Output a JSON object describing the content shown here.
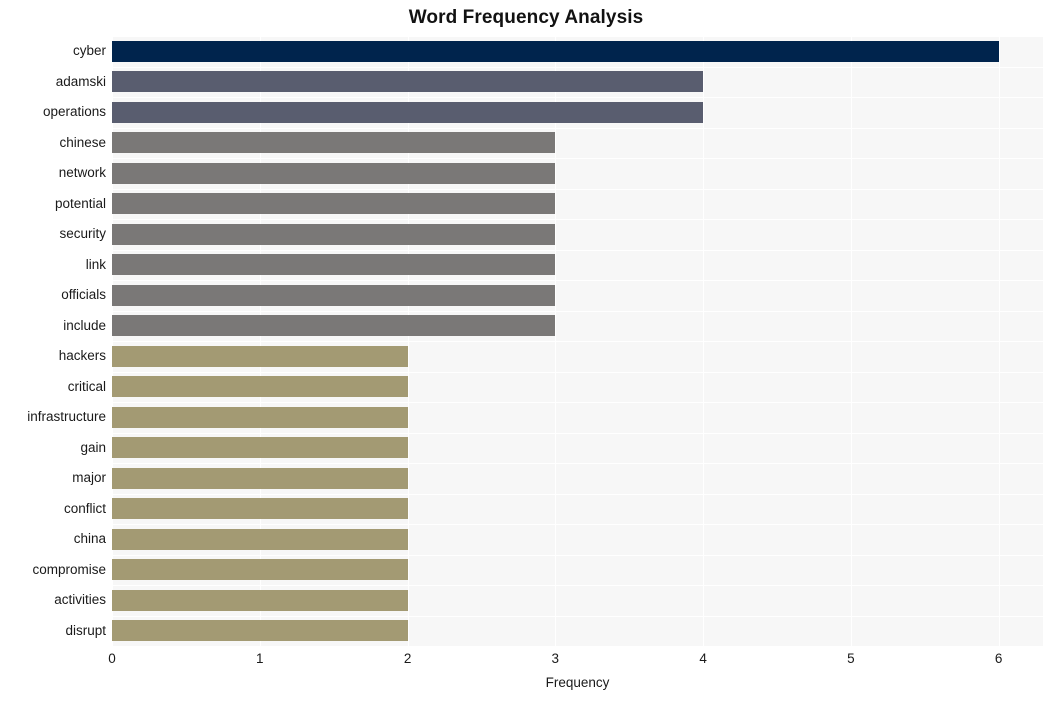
{
  "chart_data": {
    "type": "bar",
    "orientation": "horizontal",
    "title": "Word Frequency Analysis",
    "xlabel": "Frequency",
    "ylabel": "",
    "xlim": [
      0,
      6.3
    ],
    "ylim": [
      0,
      20
    ],
    "grid": true,
    "legend": false,
    "xticks": [
      "0",
      "1",
      "2",
      "3",
      "4",
      "5",
      "6"
    ],
    "xtick_values": [
      0,
      1,
      2,
      3,
      4,
      5,
      6
    ],
    "categories": [
      "cyber",
      "adamski",
      "operations",
      "chinese",
      "network",
      "potential",
      "security",
      "link",
      "officials",
      "include",
      "hackers",
      "critical",
      "infrastructure",
      "gain",
      "major",
      "conflict",
      "china",
      "compromise",
      "activities",
      "disrupt"
    ],
    "values": [
      6,
      4,
      4,
      3,
      3,
      3,
      3,
      3,
      3,
      3,
      2,
      2,
      2,
      2,
      2,
      2,
      2,
      2,
      2,
      2
    ],
    "colors": [
      "#00244d",
      "#595d6f",
      "#595d6f",
      "#7a7877",
      "#7a7877",
      "#7a7877",
      "#7a7877",
      "#7a7877",
      "#7a7877",
      "#7a7877",
      "#a39a73",
      "#a39a73",
      "#a39a73",
      "#a39a73",
      "#a39a73",
      "#a39a73",
      "#a39a73",
      "#a39a73",
      "#a39a73",
      "#a39a73"
    ],
    "plot_background": "#f7f7f7",
    "gridline_color": "#ffffff",
    "figure_background": "#ffffff",
    "title_color": "#121212",
    "tick_label_color": "#1a1a1a"
  }
}
